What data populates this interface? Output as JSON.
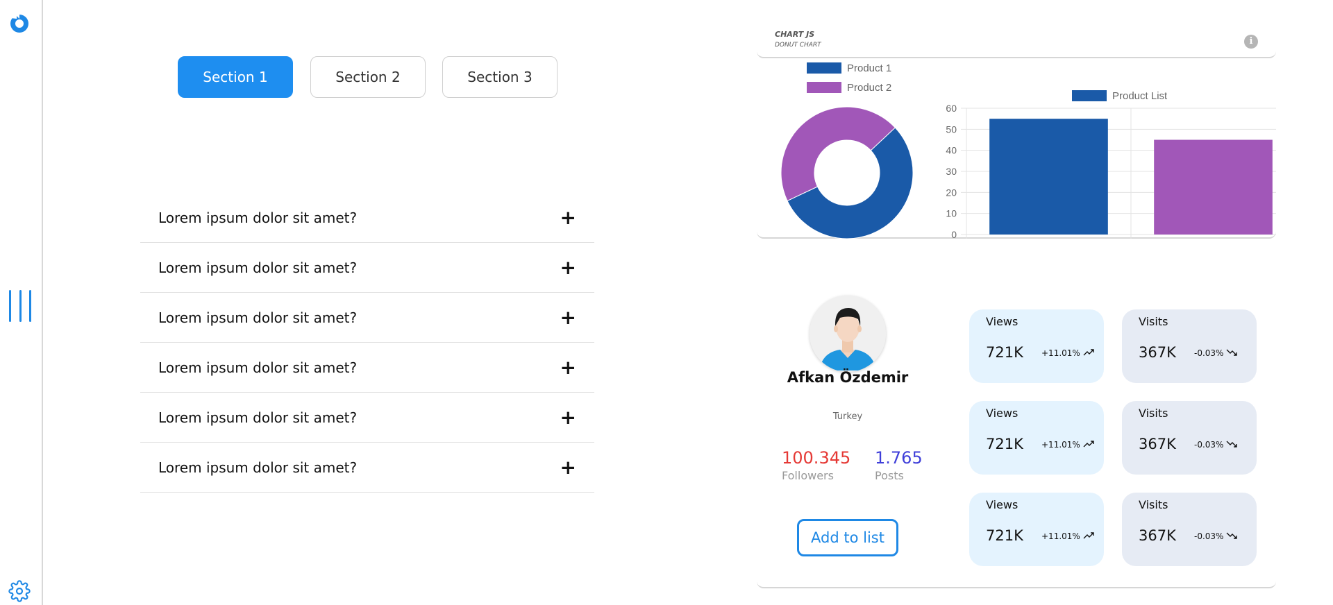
{
  "sections": [
    "Section 1",
    "Section 2",
    "Section 3"
  ],
  "faq": [
    "Lorem ipsum dolor sit amet?",
    "Lorem ipsum dolor sit amet?",
    "Lorem ipsum dolor sit amet?",
    "Lorem ipsum dolor sit amet?",
    "Lorem ipsum dolor sit amet?",
    "Lorem ipsum dolor sit amet?"
  ],
  "faq_toggle": "+",
  "chart_card": {
    "title": "CHART JS",
    "subtitle": "DONUT CHART",
    "info_glyph": "i"
  },
  "chart_data": [
    {
      "type": "donut",
      "categories": [
        "Product 1",
        "Product 2"
      ],
      "values": [
        55,
        45
      ],
      "colors": [
        "#1a5aa8",
        "#a157b8"
      ],
      "legend": "top"
    },
    {
      "type": "bar",
      "categories": [
        "Product 1",
        "Product 2"
      ],
      "series": [
        {
          "name": "Product List",
          "values": [
            55,
            45
          ]
        }
      ],
      "colors": [
        "#1a5aa8",
        "#a157b8"
      ],
      "ylim": [
        0,
        60
      ],
      "yticks": [
        "0",
        "10",
        "20",
        "30",
        "40",
        "50",
        "60"
      ],
      "grid": true,
      "legend": "top"
    }
  ],
  "profile": {
    "name": "Afkan Özdemir",
    "country": "Turkey",
    "followers_value": "100.345",
    "followers_label": "Followers",
    "posts_value": "1.765",
    "posts_label": "Posts",
    "add_button": "Add to list"
  },
  "metrics": [
    {
      "title": "Views",
      "value": "721K",
      "change": "+11.01%"
    },
    {
      "title": "Visits",
      "value": "367K",
      "change": "-0.03%"
    },
    {
      "title": "Views",
      "value": "721K",
      "change": "+11.01%"
    },
    {
      "title": "Visits",
      "value": "367K",
      "change": "-0.03%"
    },
    {
      "title": "Views",
      "value": "721K",
      "change": "+11.01%"
    },
    {
      "title": "Visits",
      "value": "367K",
      "change": "-0.03%"
    }
  ],
  "colors": {
    "accent": "#1e88e5",
    "followers": "#e53935",
    "posts": "#3f3fd9"
  },
  "icons": [
    "logo-icon",
    "menu-bars-icon",
    "gear-icon",
    "info-icon",
    "trend-up-icon",
    "trend-down-icon",
    "plus-icon"
  ]
}
